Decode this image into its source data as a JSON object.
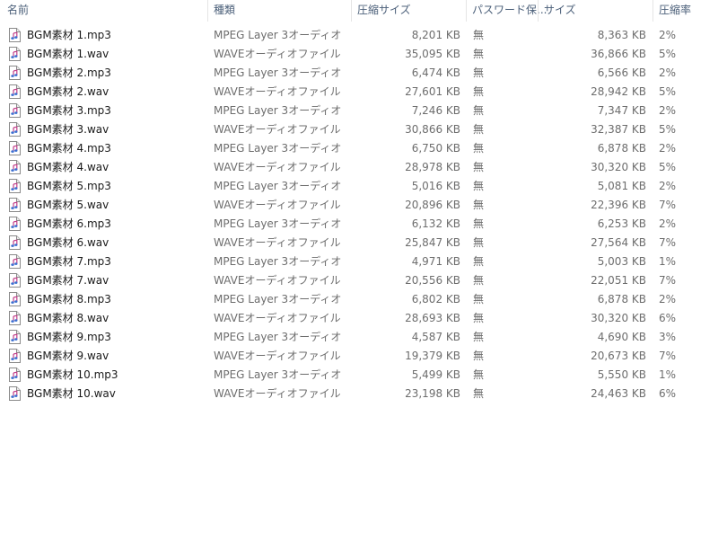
{
  "columns": {
    "name": "名前",
    "type": "種類",
    "compressed_size": "圧縮サイズ",
    "password": "パスワード保...",
    "size": "サイズ",
    "ratio": "圧縮率"
  },
  "sort_indicator": "^",
  "icon": "audio-file-icon",
  "files": [
    {
      "name": "BGM素材 1.mp3",
      "type": "MPEG Layer 3オーディオ",
      "compressed": "8,201 KB",
      "password": "無",
      "size": "8,363 KB",
      "ratio": "2%"
    },
    {
      "name": "BGM素材 1.wav",
      "type": "WAVEオーディオファイル",
      "compressed": "35,095 KB",
      "password": "無",
      "size": "36,866 KB",
      "ratio": "5%"
    },
    {
      "name": "BGM素材 2.mp3",
      "type": "MPEG Layer 3オーディオ",
      "compressed": "6,474 KB",
      "password": "無",
      "size": "6,566 KB",
      "ratio": "2%"
    },
    {
      "name": "BGM素材 2.wav",
      "type": "WAVEオーディオファイル",
      "compressed": "27,601 KB",
      "password": "無",
      "size": "28,942 KB",
      "ratio": "5%"
    },
    {
      "name": "BGM素材 3.mp3",
      "type": "MPEG Layer 3オーディオ",
      "compressed": "7,246 KB",
      "password": "無",
      "size": "7,347 KB",
      "ratio": "2%"
    },
    {
      "name": "BGM素材 3.wav",
      "type": "WAVEオーディオファイル",
      "compressed": "30,866 KB",
      "password": "無",
      "size": "32,387 KB",
      "ratio": "5%"
    },
    {
      "name": "BGM素材 4.mp3",
      "type": "MPEG Layer 3オーディオ",
      "compressed": "6,750 KB",
      "password": "無",
      "size": "6,878 KB",
      "ratio": "2%"
    },
    {
      "name": "BGM素材 4.wav",
      "type": "WAVEオーディオファイル",
      "compressed": "28,978 KB",
      "password": "無",
      "size": "30,320 KB",
      "ratio": "5%"
    },
    {
      "name": "BGM素材 5.mp3",
      "type": "MPEG Layer 3オーディオ",
      "compressed": "5,016 KB",
      "password": "無",
      "size": "5,081 KB",
      "ratio": "2%"
    },
    {
      "name": "BGM素材 5.wav",
      "type": "WAVEオーディオファイル",
      "compressed": "20,896 KB",
      "password": "無",
      "size": "22,396 KB",
      "ratio": "7%"
    },
    {
      "name": "BGM素材 6.mp3",
      "type": "MPEG Layer 3オーディオ",
      "compressed": "6,132 KB",
      "password": "無",
      "size": "6,253 KB",
      "ratio": "2%"
    },
    {
      "name": "BGM素材 6.wav",
      "type": "WAVEオーディオファイル",
      "compressed": "25,847 KB",
      "password": "無",
      "size": "27,564 KB",
      "ratio": "7%"
    },
    {
      "name": "BGM素材 7.mp3",
      "type": "MPEG Layer 3オーディオ",
      "compressed": "4,971 KB",
      "password": "無",
      "size": "5,003 KB",
      "ratio": "1%"
    },
    {
      "name": "BGM素材 7.wav",
      "type": "WAVEオーディオファイル",
      "compressed": "20,556 KB",
      "password": "無",
      "size": "22,051 KB",
      "ratio": "7%"
    },
    {
      "name": "BGM素材 8.mp3",
      "type": "MPEG Layer 3オーディオ",
      "compressed": "6,802 KB",
      "password": "無",
      "size": "6,878 KB",
      "ratio": "2%"
    },
    {
      "name": "BGM素材 8.wav",
      "type": "WAVEオーディオファイル",
      "compressed": "28,693 KB",
      "password": "無",
      "size": "30,320 KB",
      "ratio": "6%"
    },
    {
      "name": "BGM素材 9.mp3",
      "type": "MPEG Layer 3オーディオ",
      "compressed": "4,587 KB",
      "password": "無",
      "size": "4,690 KB",
      "ratio": "3%"
    },
    {
      "name": "BGM素材 9.wav",
      "type": "WAVEオーディオファイル",
      "compressed": "19,379 KB",
      "password": "無",
      "size": "20,673 KB",
      "ratio": "7%"
    },
    {
      "name": "BGM素材 10.mp3",
      "type": "MPEG Layer 3オーディオ",
      "compressed": "5,499 KB",
      "password": "無",
      "size": "5,550 KB",
      "ratio": "1%"
    },
    {
      "name": "BGM素材 10.wav",
      "type": "WAVEオーディオファイル",
      "compressed": "23,198 KB",
      "password": "無",
      "size": "24,463 KB",
      "ratio": "6%"
    }
  ]
}
